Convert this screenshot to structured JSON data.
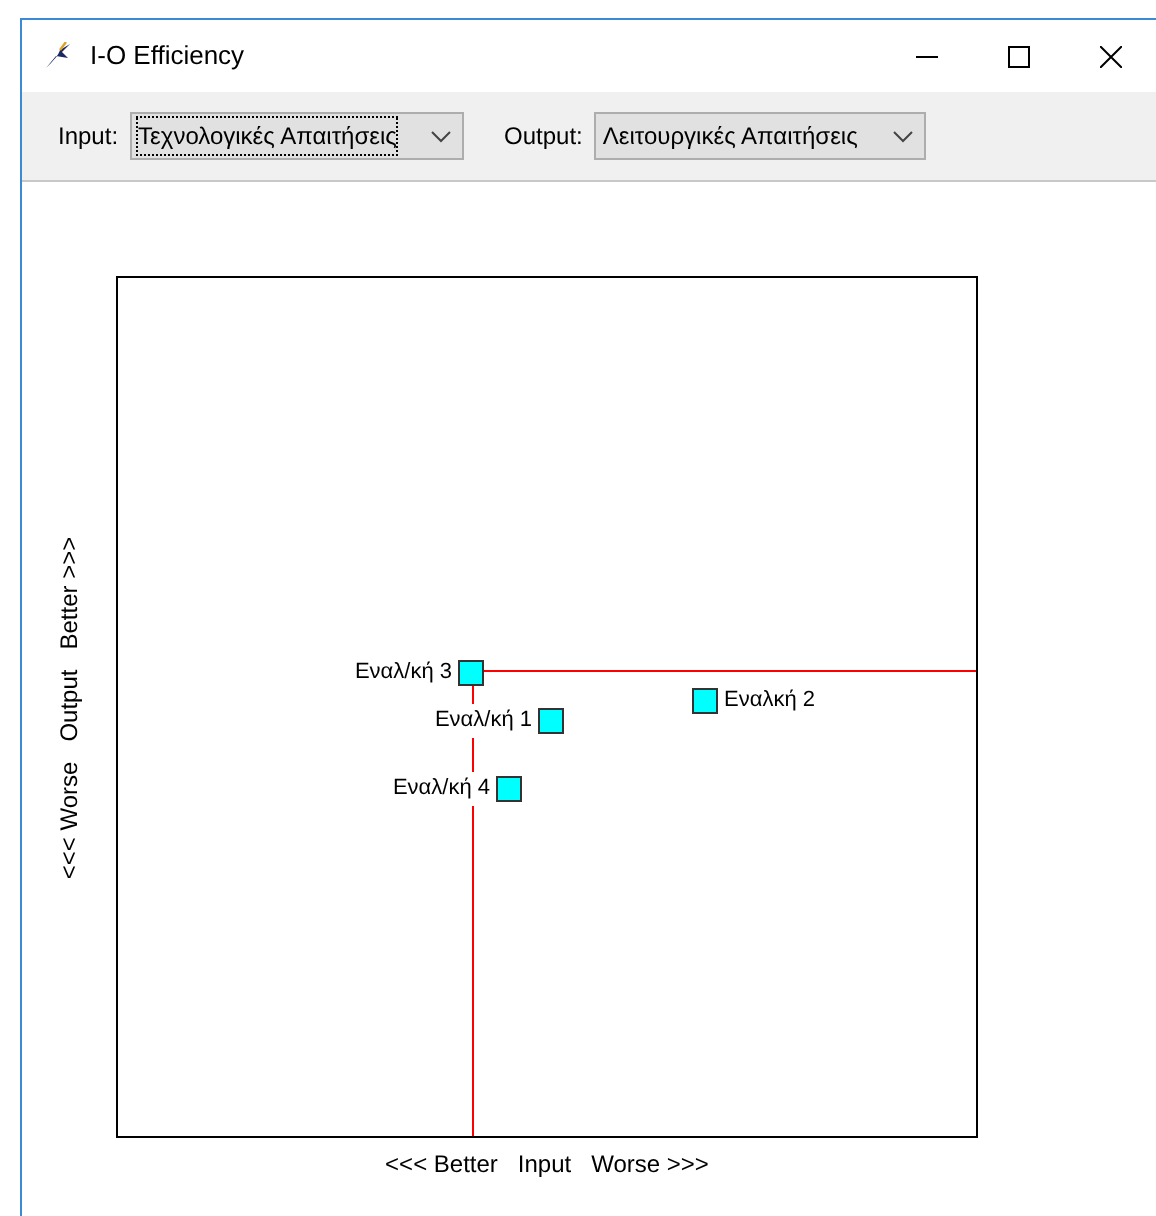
{
  "window": {
    "title": "I-O Efficiency"
  },
  "toolbar": {
    "input": {
      "label": "Input:",
      "value": "Τεχνολογικές Απαιτήσεις",
      "focused": true
    },
    "output": {
      "label": "Output:",
      "value": "Λειτουργικές Απαιτήσεις",
      "focused": false
    }
  },
  "plot": {
    "y_axis_label": "<<< Worse   Output   Better >>>",
    "x_axis_label": "<<< Better   Input   Worse >>>",
    "points": [
      {
        "label": "Εναλ/κή 3",
        "kind": "left"
      },
      {
        "label": "Εναλ/κή 1",
        "kind": "left"
      },
      {
        "label": "Εναλκή 2",
        "kind": "right"
      },
      {
        "label": "Εναλ/κή 4",
        "kind": "left"
      }
    ]
  }
}
